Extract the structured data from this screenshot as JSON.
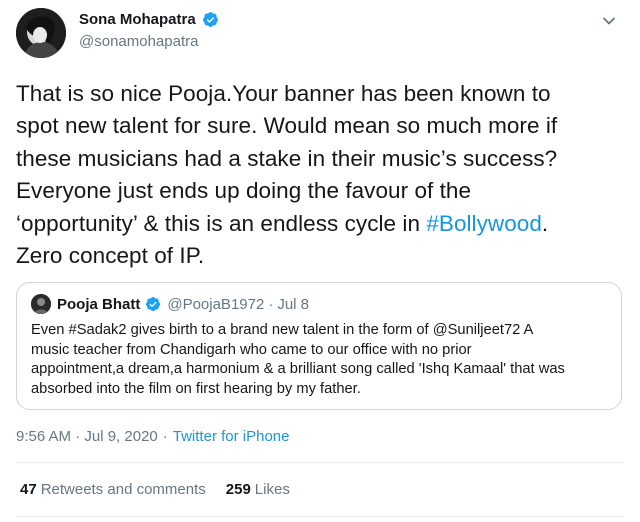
{
  "tweet": {
    "author": {
      "display_name": "Sona Mohapatra",
      "handle": "@sonamohapatra",
      "verified": true,
      "avatar_icon": "profile-photo"
    },
    "menu_icon": "chevron-down-icon",
    "text_lines": [
      "That is so nice Pooja.Your banner has been known to",
      "spot new talent for sure. Would mean so much more if",
      "these musicians had a stake in their music’s success?",
      "Everyone just ends up doing the favour of the",
      "‘opportunity’ & this is an endless cycle in ",
      "#Bollywood",
      ".",
      "Zero concept of IP."
    ],
    "quoted": {
      "display_name": "Pooja Bhatt",
      "handle": "@PoojaB1972",
      "separator": "·",
      "date": "Jul 8",
      "verified": true,
      "text_lines": [
        "Even #Sadak2 gives birth to a brand new talent in the form of @Suniljeet72 A",
        "music teacher from Chandigarh who came to our office with no prior",
        "appointment,a dream,a harmonium & a brilliant song called 'Ishq Kamaal' that was",
        "absorbed into the film on first hearing by my father."
      ]
    },
    "timestamp": "9:56 AM · Jul 9, 2020",
    "separator": "·",
    "source": "Twitter for iPhone",
    "stats": {
      "retweets_count": "47",
      "retweets_label": "Retweets and comments",
      "likes_count": "259",
      "likes_label": "Likes"
    },
    "colors": {
      "link": "#1b95e0",
      "secondary_text": "#657786",
      "border": "#ccd6dd",
      "verified_badge": "#1da1f2"
    }
  }
}
